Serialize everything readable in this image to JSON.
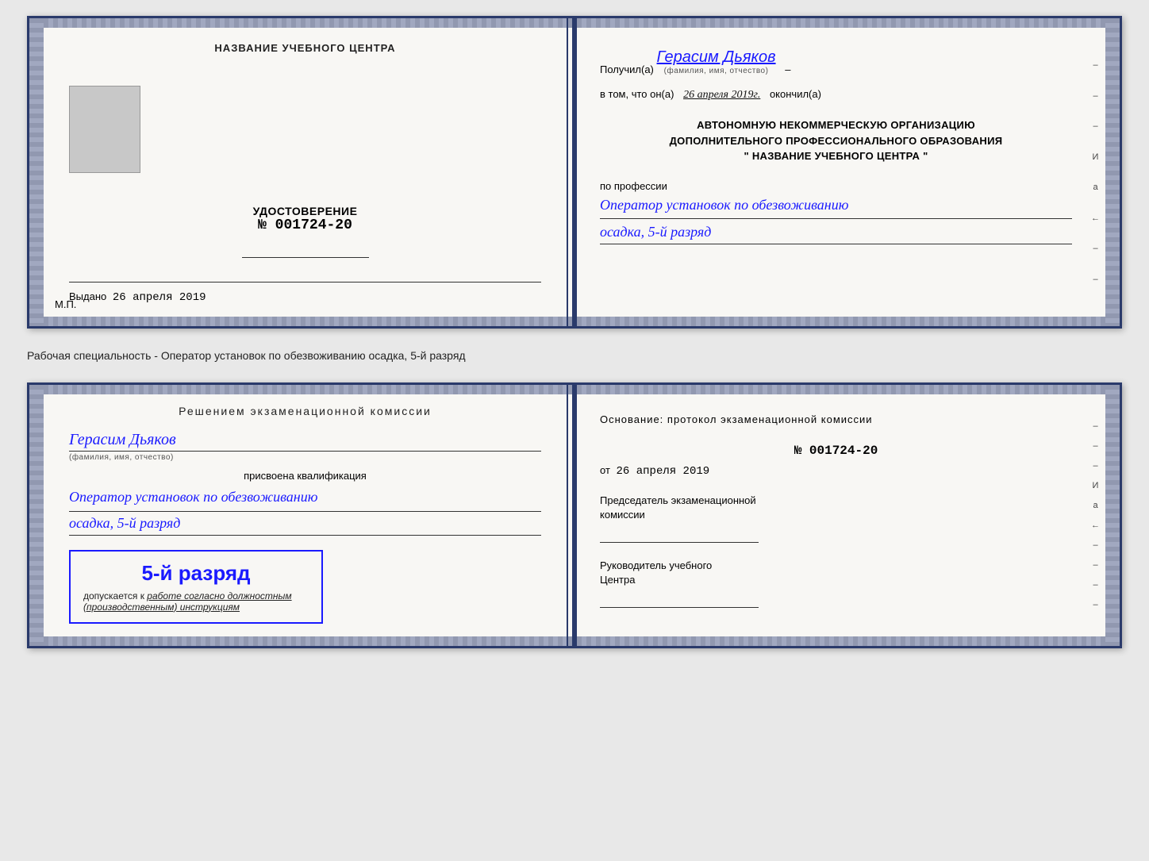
{
  "upper_doc": {
    "left": {
      "center_title": "НАЗВАНИЕ УЧЕБНОГО ЦЕНТРА",
      "cert_label": "УДОСТОВЕРЕНИЕ",
      "cert_number": "№ 001724-20",
      "issued_label": "Выдано",
      "issued_date": "26 апреля 2019",
      "mp_label": "М.П."
    },
    "right": {
      "received_label": "Получил(а)",
      "recipient_name": "Герасим Дьяков",
      "name_sublabel": "(фамилия, имя, отчество)",
      "dash": "–",
      "completed_prefix": "в том, что он(а)",
      "completed_date": "26 апреля 2019г.",
      "completed_suffix": "окончил(а)",
      "org_line1": "АВТОНОМНУЮ НЕКОММЕРЧЕСКУЮ ОРГАНИЗАЦИЮ",
      "org_line2": "ДОПОЛНИТЕЛЬНОГО ПРОФЕССИОНАЛЬНОГО ОБРАЗОВАНИЯ",
      "org_name": "\"  НАЗВАНИЕ УЧЕБНОГО ЦЕНТРА  \"",
      "profession_label": "по профессии",
      "profession_value": "Оператор установок по обезвоживанию",
      "rank_value": "осадка, 5-й разряд"
    }
  },
  "separator": {
    "text": "Рабочая специальность - Оператор установок по обезвоживанию осадка, 5-й разряд"
  },
  "lower_doc": {
    "left": {
      "decision_heading": "Решением  экзаменационной  комиссии",
      "commission_name": "Герасим Дьяков",
      "name_sublabel": "(фамилия, имя, отчество)",
      "assigned_label": "присвоена квалификация",
      "qual_profession": "Оператор установок по обезвоживанию",
      "rank_value": "осадка, 5-й разряд",
      "stamp_rank": "5-й разряд",
      "stamp_allowed_prefix": "допускается к",
      "stamp_italic": "работе согласно должностным",
      "stamp_italic2": "(производственным) инструкциям"
    },
    "right": {
      "basis_label": "Основание: протокол экзаменационной  комиссии",
      "protocol_number": "№  001724-20",
      "date_prefix": "от",
      "protocol_date": "26 апреля 2019",
      "chair_label_line1": "Председатель экзаменационной",
      "chair_label_line2": "комиссии",
      "director_label_line1": "Руководитель учебного",
      "director_label_line2": "Центра"
    },
    "right_marks": [
      "–",
      "–",
      "–",
      "И",
      "а",
      "←",
      "–",
      "–",
      "–",
      "–"
    ]
  }
}
